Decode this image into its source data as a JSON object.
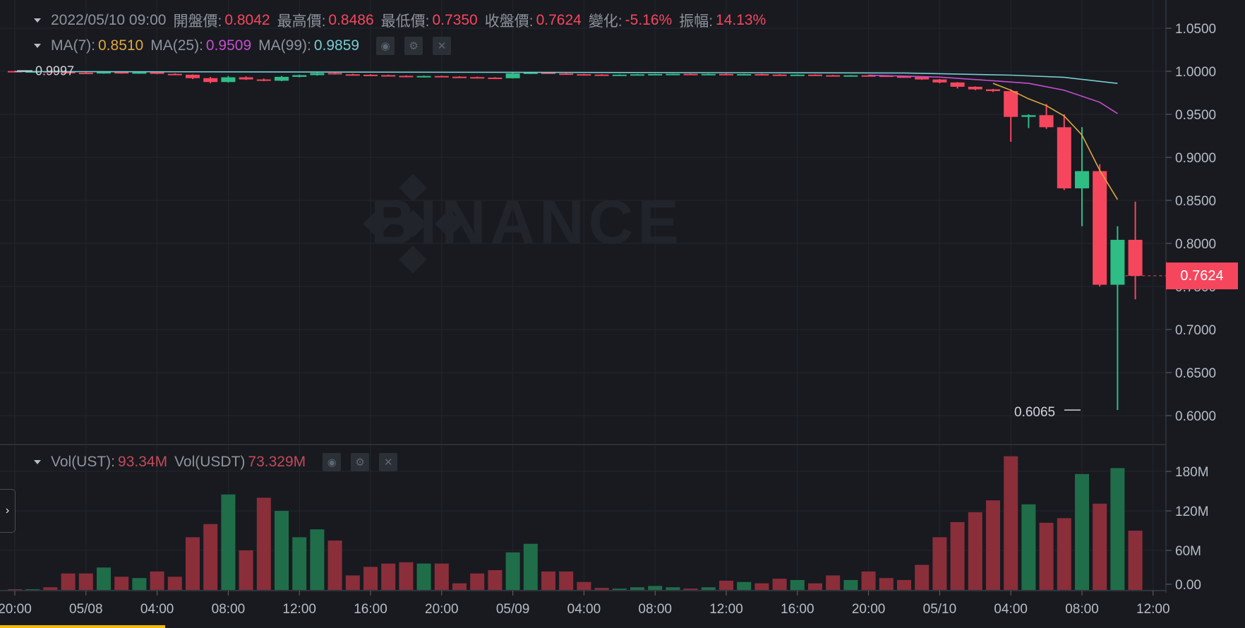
{
  "header": {
    "date": "2022/05/10 09:00",
    "open_label": "開盤價:",
    "open_value": "0.8042",
    "high_label": "最高價:",
    "high_value": "0.8486",
    "low_label": "最低價:",
    "low_value": "0.7350",
    "close_label": "收盤價:",
    "close_value": "0.7624",
    "change_label": "變化:",
    "change_value": "-5.16%",
    "amplitude_label": "振幅:",
    "amplitude_value": "14.13%"
  },
  "ma_row": {
    "ma7_label": "MA(7):",
    "ma7_value": "0.8510",
    "ma25_label": "MA(25):",
    "ma25_value": "0.9509",
    "ma99_label": "MA(99):",
    "ma99_value": "0.9859",
    "eye_icon": "eye-icon",
    "gear_icon": "gear-icon",
    "close_icon": "close-icon"
  },
  "vol_row": {
    "vol_ust_label": "Vol(UST):",
    "vol_ust_value": "93.34M",
    "vol_usdt_label": "Vol(USDT)",
    "vol_usdt_value": "73.329M"
  },
  "watermark": "BINANCE",
  "current_price": "0.7624",
  "high_marker": "0.9997",
  "low_marker": "0.6065",
  "colors": {
    "background": "#181a20",
    "up": "#2ebd85",
    "down": "#f6465d",
    "vol_up": "#1f6e49",
    "vol_down": "#8a2e3a",
    "ma7": "#e0a73e",
    "ma25": "#c74ecf",
    "ma99": "#78cdd0",
    "grid": "#22252c",
    "axis_text": "#b7bdc6"
  },
  "chart_data": {
    "type": "candlestick",
    "interval": "1h",
    "price_axis": {
      "ticks": [
        "1.0500",
        "1.0000",
        "0.9500",
        "0.9000",
        "0.8500",
        "0.8000",
        "0.7500",
        "0.7000",
        "0.6500",
        "0.6000"
      ],
      "range": [
        0.585,
        1.06
      ]
    },
    "volume_axis": {
      "ticks": [
        "180M",
        "120M",
        "60M",
        "0.00"
      ],
      "range": [
        0,
        210
      ]
    },
    "time_axis": {
      "ticks": [
        "20:00",
        "05/08",
        "04:00",
        "08:00",
        "12:00",
        "16:00",
        "20:00",
        "05/09",
        "04:00",
        "08:00",
        "12:00",
        "16:00",
        "20:00",
        "05/10",
        "04:00",
        "08:00",
        "12:00"
      ]
    },
    "x_start": "2022-05-07 20:00",
    "candles": [
      [
        1.0003,
        1.0006,
        0.9992,
        0.9994,
        1
      ],
      [
        0.9994,
        1.0003,
        0.999,
        1.0,
        1
      ],
      [
        1.0,
        1.0002,
        0.9987,
        0.9992,
        4
      ],
      [
        0.9992,
        0.9997,
        0.998,
        0.9983,
        25
      ],
      [
        0.9983,
        0.9989,
        0.9975,
        0.9978,
        25
      ],
      [
        0.9978,
        0.9995,
        0.9972,
        0.999,
        34
      ],
      [
        0.999,
        0.9994,
        0.9972,
        0.9975,
        20
      ],
      [
        0.9975,
        0.9992,
        0.997,
        0.9988,
        18
      ],
      [
        0.9988,
        0.9991,
        0.9966,
        0.997,
        28
      ],
      [
        0.997,
        0.9976,
        0.9955,
        0.996,
        20
      ],
      [
        0.996,
        0.9964,
        0.991,
        0.992,
        80
      ],
      [
        0.992,
        0.9935,
        0.986,
        0.9875,
        100
      ],
      [
        0.9875,
        0.9945,
        0.987,
        0.993,
        145
      ],
      [
        0.993,
        0.994,
        0.99,
        0.9905,
        60
      ],
      [
        0.9905,
        0.9915,
        0.9885,
        0.989,
        140
      ],
      [
        0.989,
        0.9945,
        0.9885,
        0.9935,
        120
      ],
      [
        0.9935,
        0.996,
        0.993,
        0.9955,
        80
      ],
      [
        0.9955,
        0.9985,
        0.995,
        0.998,
        92
      ],
      [
        0.998,
        0.9986,
        0.9962,
        0.9965,
        75
      ],
      [
        0.9965,
        0.9972,
        0.9955,
        0.996,
        22
      ],
      [
        0.996,
        0.9966,
        0.995,
        0.9955,
        35
      ],
      [
        0.9955,
        0.996,
        0.9942,
        0.9947,
        40
      ],
      [
        0.9947,
        0.9952,
        0.9938,
        0.9942,
        42
      ],
      [
        0.9942,
        0.995,
        0.9932,
        0.9945,
        40
      ],
      [
        0.9945,
        0.9948,
        0.9933,
        0.9937,
        40
      ],
      [
        0.9937,
        0.9942,
        0.9928,
        0.9932,
        10
      ],
      [
        0.9932,
        0.9938,
        0.9922,
        0.9926,
        25
      ],
      [
        0.9926,
        0.9931,
        0.9915,
        0.9919,
        30
      ],
      [
        0.9919,
        0.998,
        0.9917,
        0.9975,
        57
      ],
      [
        0.9975,
        0.999,
        0.9968,
        0.9985,
        70
      ],
      [
        0.9985,
        0.9987,
        0.997,
        0.9974,
        28
      ],
      [
        0.9974,
        0.9978,
        0.9962,
        0.9966,
        28
      ],
      [
        0.9966,
        0.997,
        0.9959,
        0.9962,
        12
      ],
      [
        0.9962,
        0.9966,
        0.9955,
        0.9958,
        3
      ],
      [
        0.9958,
        0.9964,
        0.9955,
        0.9961,
        2
      ],
      [
        0.9961,
        0.9968,
        0.9958,
        0.9965,
        4
      ],
      [
        0.9965,
        0.997,
        0.996,
        0.9968,
        6
      ],
      [
        0.9968,
        0.9972,
        0.9962,
        0.997,
        4
      ],
      [
        0.997,
        0.9974,
        0.9964,
        0.9967,
        2
      ],
      [
        0.9967,
        0.9972,
        0.9963,
        0.9969,
        4
      ],
      [
        0.9969,
        0.9974,
        0.9962,
        0.9965,
        14
      ],
      [
        0.9965,
        0.997,
        0.996,
        0.9967,
        12
      ],
      [
        0.9967,
        0.9971,
        0.9958,
        0.9962,
        10
      ],
      [
        0.9962,
        0.9967,
        0.9952,
        0.9957,
        17
      ],
      [
        0.9957,
        0.9964,
        0.9952,
        0.9961,
        15
      ],
      [
        0.9961,
        0.9964,
        0.995,
        0.9954,
        10
      ],
      [
        0.9954,
        0.9958,
        0.9943,
        0.9948,
        22
      ],
      [
        0.9948,
        0.9955,
        0.9944,
        0.9953,
        15
      ],
      [
        0.9953,
        0.9958,
        0.9944,
        0.995,
        28
      ],
      [
        0.995,
        0.9954,
        0.9935,
        0.994,
        18
      ],
      [
        0.994,
        0.9945,
        0.9928,
        0.9933,
        15
      ],
      [
        0.9933,
        0.9938,
        0.99,
        0.9905,
        38
      ],
      [
        0.9905,
        0.991,
        0.986,
        0.987,
        80
      ],
      [
        0.987,
        0.9875,
        0.98,
        0.982,
        103
      ],
      [
        0.982,
        0.9825,
        0.978,
        0.979,
        118
      ],
      [
        0.979,
        0.9795,
        0.976,
        0.977,
        136
      ],
      [
        0.977,
        0.979,
        0.918,
        0.947,
        203
      ],
      [
        0.947,
        0.95,
        0.934,
        0.949,
        130
      ],
      [
        0.949,
        0.962,
        0.933,
        0.935,
        102
      ],
      [
        0.935,
        0.95,
        0.862,
        0.864,
        109
      ],
      [
        0.864,
        0.935,
        0.82,
        0.884,
        176
      ],
      [
        0.884,
        0.892,
        0.75,
        0.752,
        131
      ],
      [
        0.752,
        0.82,
        0.6065,
        0.8042,
        185
      ],
      [
        0.8042,
        0.8486,
        0.735,
        0.7624,
        90
      ]
    ],
    "ma7": [
      [
        55,
        0.986
      ],
      [
        56,
        0.978
      ],
      [
        57,
        0.968
      ],
      [
        58,
        0.96
      ],
      [
        59,
        0.948
      ],
      [
        60,
        0.926
      ],
      [
        61,
        0.885
      ],
      [
        62,
        0.851
      ]
    ],
    "ma25": [
      [
        48,
        0.9955
      ],
      [
        52,
        0.9932
      ],
      [
        55,
        0.989
      ],
      [
        57,
        0.986
      ],
      [
        59,
        0.978
      ],
      [
        61,
        0.964
      ],
      [
        62,
        0.9509
      ]
    ],
    "ma99": [
      [
        0,
        0.9997
      ],
      [
        50,
        0.998
      ],
      [
        56,
        0.9955
      ],
      [
        59,
        0.993
      ],
      [
        62,
        0.9859
      ]
    ]
  }
}
